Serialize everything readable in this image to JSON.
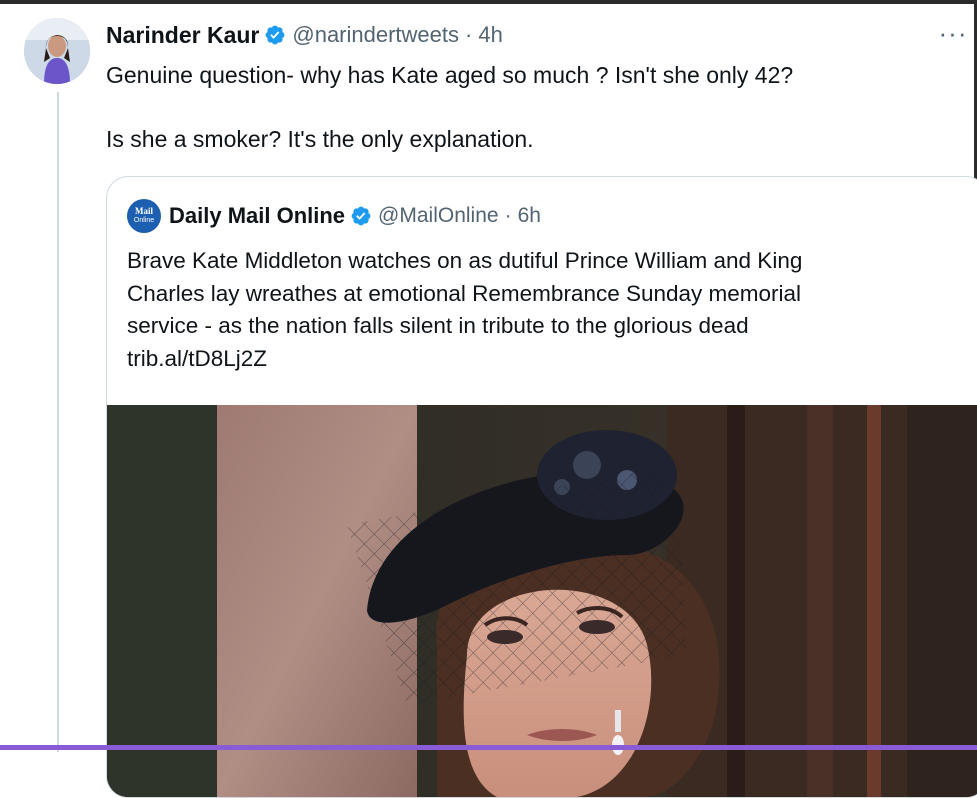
{
  "tweet": {
    "author_name": "Narinder Kaur",
    "handle": "@narindertweets",
    "time": "4h",
    "more_label": "···",
    "text_line1": "Genuine question- why has Kate aged so much ? Isn't she only 42?",
    "text_line2": "Is she a smoker? It's the only explanation."
  },
  "quoted_tweet": {
    "logo_line1": "Mail",
    "logo_line2": "Online",
    "author_name": "Daily Mail Online",
    "handle": "@MailOnline",
    "time": "6h",
    "text_lines": [
      "Brave Kate Middleton watches on as dutiful Prince William and King",
      "Charles lay wreathes at emotional Remembrance Sunday memorial",
      "service - as the nation falls silent in tribute to the glorious dead",
      "trib.al/tD8Lj2Z"
    ]
  },
  "colors": {
    "verified": "#1d9bf0",
    "secondary_text": "#536471",
    "border": "#cfd9de",
    "mail_logo": "#1c5fb0"
  },
  "icons": {
    "verified": "verified-badge-icon",
    "more": "more-horizontal-icon"
  }
}
